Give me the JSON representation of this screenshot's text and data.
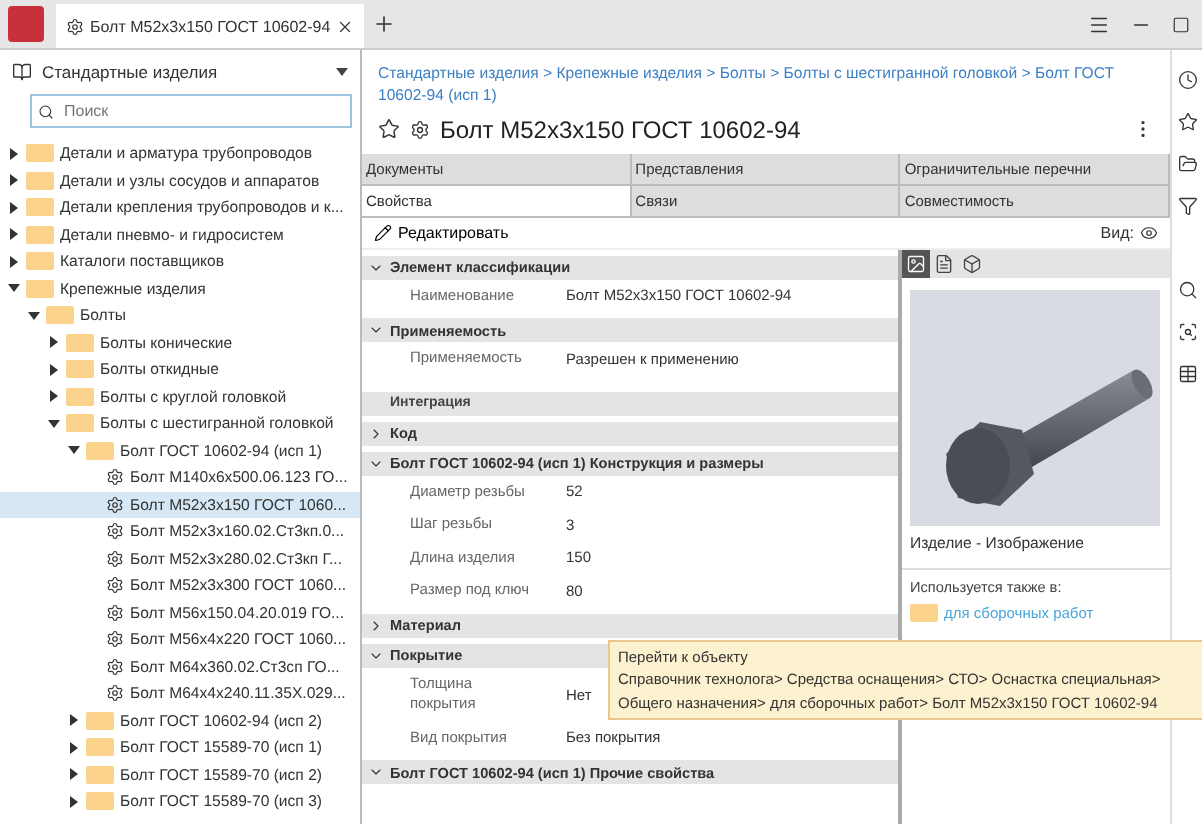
{
  "app_tab": {
    "title": "Болт М52х3х150 ГОСТ 10602-94"
  },
  "library": {
    "title": "Стандартные изделия",
    "search_placeholder": "Поиск"
  },
  "tree": [
    {
      "label": "Детали и арматура трубопроводов",
      "kind": "folder",
      "expanded": false,
      "selected": false
    },
    {
      "label": "Детали и узлы сосудов и аппаратов",
      "kind": "folder",
      "expanded": false,
      "selected": false
    },
    {
      "label": "Детали крепления трубопроводов и к...",
      "kind": "folder",
      "expanded": false,
      "selected": false
    },
    {
      "label": "Детали пневмо- и гидросистем",
      "kind": "folder",
      "expanded": false,
      "selected": false
    },
    {
      "label": "Каталоги поставщиков",
      "kind": "folder",
      "expanded": false,
      "selected": false
    },
    {
      "label": "Крепежные изделия",
      "kind": "folder",
      "expanded": true,
      "selected": false,
      "children": [
        {
          "label": "Болты",
          "kind": "folder",
          "expanded": true,
          "selected": false,
          "children": [
            {
              "label": "Болты конические",
              "kind": "folder",
              "expanded": false,
              "selected": false
            },
            {
              "label": "Болты откидные",
              "kind": "folder",
              "expanded": false,
              "selected": false
            },
            {
              "label": "Болты с круглой головкой",
              "kind": "folder",
              "expanded": false,
              "selected": false
            },
            {
              "label": "Болты с шестигранной головкой",
              "kind": "folder",
              "expanded": true,
              "selected": false,
              "children": [
                {
                  "label": "Болт ГОСТ 10602-94 (исп 1)",
                  "kind": "folder",
                  "expanded": true,
                  "selected": false,
                  "children": [
                    {
                      "label": "Болт М140х6х500.06.123 ГО...",
                      "kind": "item",
                      "selected": false
                    },
                    {
                      "label": "Болт М52х3х150 ГОСТ 1060...",
                      "kind": "item",
                      "selected": true
                    },
                    {
                      "label": "Болт М52х3х160.02.Ст3кп.0...",
                      "kind": "item",
                      "selected": false
                    },
                    {
                      "label": "Болт М52х3х280.02.Ст3кп Г...",
                      "kind": "item",
                      "selected": false
                    },
                    {
                      "label": "Болт М52х3х300 ГОСТ 1060...",
                      "kind": "item",
                      "selected": false
                    },
                    {
                      "label": "Болт М56х150.04.20.019 ГО...",
                      "kind": "item",
                      "selected": false
                    },
                    {
                      "label": "Болт М56х4х220 ГОСТ 1060...",
                      "kind": "item",
                      "selected": false
                    },
                    {
                      "label": "Болт М64х360.02.Ст3сп ГО...",
                      "kind": "item",
                      "selected": false
                    },
                    {
                      "label": "Болт М64х4х240.11.35Х.029...",
                      "kind": "item",
                      "selected": false
                    }
                  ]
                },
                {
                  "label": "Болт ГОСТ 10602-94 (исп 2)",
                  "kind": "folder",
                  "expanded": false,
                  "selected": false
                },
                {
                  "label": "Болт ГОСТ 15589-70 (исп 1)",
                  "kind": "folder",
                  "expanded": false,
                  "selected": false
                },
                {
                  "label": "Болт ГОСТ 15589-70 (исп 2)",
                  "kind": "folder",
                  "expanded": false,
                  "selected": false
                },
                {
                  "label": "Болт ГОСТ 15589-70 (исп 3)",
                  "kind": "folder",
                  "expanded": false,
                  "selected": false
                }
              ]
            }
          ]
        }
      ]
    }
  ],
  "breadcrumb": "Стандартные изделия > Крепежные изделия > Болты > Болты с шестигранной головкой > Болт ГОСТ 10602-94 (исп 1)",
  "title": "Болт М52х3х150 ГОСТ 10602-94",
  "tab_rows": [
    [
      {
        "label": "Документы",
        "selected": false
      },
      {
        "label": "Представления",
        "selected": false
      },
      {
        "label": "Ограничительные перечни",
        "selected": false
      }
    ],
    [
      {
        "label": "Свойства",
        "selected": true
      },
      {
        "label": "Связи",
        "selected": false
      },
      {
        "label": "Совместимость",
        "selected": false
      }
    ]
  ],
  "toolbar": {
    "edit": "Редактировать",
    "view": "Вид:"
  },
  "sections": [
    {
      "kind": "group",
      "title": "Элемент классификации",
      "expanded": true,
      "props": [
        {
          "name": "Наименование",
          "value": "Болт М52х3х150 ГОСТ 10602-94"
        }
      ]
    },
    {
      "kind": "group",
      "title": "Применяемость",
      "expanded": true,
      "props": [
        {
          "name": "Применяемость",
          "value": "Разрешен к применению"
        }
      ]
    },
    {
      "kind": "label",
      "title": "Интеграция"
    },
    {
      "kind": "group",
      "title": "Код",
      "expanded": false
    },
    {
      "kind": "group",
      "title": "Болт ГОСТ 10602-94 (исп 1) Конструкция и размеры",
      "expanded": true,
      "props": [
        {
          "name": "Диаметр резьбы",
          "value": "52"
        },
        {
          "name": "Шаг резьбы",
          "value": "3"
        },
        {
          "name": "Длина изделия",
          "value": "150"
        },
        {
          "name": "Размер под ключ",
          "value": "80"
        }
      ]
    },
    {
      "kind": "group",
      "title": "Материал",
      "expanded": false
    },
    {
      "kind": "group",
      "title": "Покрытие",
      "expanded": true,
      "props": [
        {
          "name": "Толщина покрытия",
          "value": "Нет"
        },
        {
          "name": "Вид покрытия",
          "value": "Без покрытия"
        }
      ]
    },
    {
      "kind": "group",
      "title": "Болт ГОСТ 10602-94 (исп 1) Прочие свойства",
      "expanded": true
    }
  ],
  "preview": {
    "tabs": [
      {
        "kind": "image",
        "selected": true
      },
      {
        "kind": "document",
        "selected": false
      },
      {
        "kind": "model",
        "selected": false
      }
    ],
    "caption": "Изделие - Изображение",
    "used_in_label": "Используется также в:",
    "used_in_link": "для сборочных работ"
  },
  "tooltip": {
    "title": "Перейти к объекту",
    "path": "Справочник технолога> Средства оснащения> СТО> Оснастка специальная> Общего назначения> для сборочных работ> Болт М52х3х150 ГОСТ 10602-94"
  }
}
